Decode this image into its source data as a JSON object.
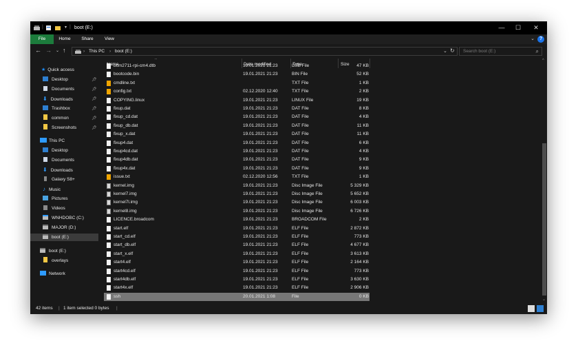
{
  "window": {
    "title": "boot (E:)",
    "controls": {
      "minimize": "—",
      "maximize": "☐",
      "close": "✕"
    }
  },
  "ribbon": {
    "tabs": [
      "File",
      "Home",
      "Share",
      "View"
    ],
    "help": "?"
  },
  "address": {
    "crumbs": [
      "This PC",
      "boot (E:)"
    ],
    "search_placeholder": "Search boot (E:)"
  },
  "nav": {
    "quick_access": "Quick access",
    "quick_items": [
      "Desktop",
      "Documents",
      "Downloads",
      "Trashbox",
      "common",
      "Screenshots"
    ],
    "this_pc": "This PC",
    "pc_items": [
      "Desktop",
      "Documents",
      "Downloads",
      "Galaxy S8+",
      "Music",
      "Pictures",
      "Videos",
      "WNHDOBC (C:)",
      "MAJOR (D:)",
      "boot (E:)"
    ],
    "drive_root": "boot (E:)",
    "drive_sub": "overlays",
    "network": "Network"
  },
  "columns": {
    "name": "Name",
    "date": "Date modified",
    "type": "Type",
    "size": "Size"
  },
  "files": [
    {
      "name": "bcm2711-rpi-cm4.dtb",
      "date": "19.01.2021 21:23",
      "type": "DTB File",
      "size": "47 KB",
      "icon": "file"
    },
    {
      "name": "bootcode.bin",
      "date": "19.01.2021 21:23",
      "type": "BIN File",
      "size": "52 KB",
      "icon": "file"
    },
    {
      "name": "cmdline.txt",
      "date": "",
      "type": "TXT File",
      "size": "1 KB",
      "icon": "config"
    },
    {
      "name": "config.txt",
      "date": "02.12.2020 12:40",
      "type": "TXT File",
      "size": "2 KB",
      "icon": "config"
    },
    {
      "name": "COPYING.linux",
      "date": "19.01.2021 21:23",
      "type": "LINUX File",
      "size": "19 KB",
      "icon": "file"
    },
    {
      "name": "fixup.dat",
      "date": "19.01.2021 21:23",
      "type": "DAT File",
      "size": "8 KB",
      "icon": "file"
    },
    {
      "name": "fixup_cd.dat",
      "date": "19.01.2021 21:23",
      "type": "DAT File",
      "size": "4 KB",
      "icon": "file"
    },
    {
      "name": "fixup_db.dat",
      "date": "19.01.2021 21:23",
      "type": "DAT File",
      "size": "11 KB",
      "icon": "file"
    },
    {
      "name": "fixup_x.dat",
      "date": "19.01.2021 21:23",
      "type": "DAT File",
      "size": "11 KB",
      "icon": "file"
    },
    {
      "name": "fixup4.dat",
      "date": "19.01.2021 21:23",
      "type": "DAT File",
      "size": "6 KB",
      "icon": "file"
    },
    {
      "name": "fixup4cd.dat",
      "date": "19.01.2021 21:23",
      "type": "DAT File",
      "size": "4 KB",
      "icon": "file"
    },
    {
      "name": "fixup4db.dat",
      "date": "19.01.2021 21:23",
      "type": "DAT File",
      "size": "9 KB",
      "icon": "file"
    },
    {
      "name": "fixup4x.dat",
      "date": "19.01.2021 21:23",
      "type": "DAT File",
      "size": "9 KB",
      "icon": "file"
    },
    {
      "name": "issue.txt",
      "date": "02.12.2020 12:56",
      "type": "TXT File",
      "size": "1 KB",
      "icon": "config"
    },
    {
      "name": "kernel.img",
      "date": "19.01.2021 21:23",
      "type": "Disc Image File",
      "size": "5 329 KB",
      "icon": "image"
    },
    {
      "name": "kernel7.img",
      "date": "19.01.2021 21:23",
      "type": "Disc Image File",
      "size": "5 652 KB",
      "icon": "image"
    },
    {
      "name": "kernel7l.img",
      "date": "19.01.2021 21:23",
      "type": "Disc Image File",
      "size": "6 003 KB",
      "icon": "image"
    },
    {
      "name": "kernel8.img",
      "date": "19.01.2021 21:23",
      "type": "Disc Image File",
      "size": "6 726 KB",
      "icon": "image"
    },
    {
      "name": "LICENCE.broadcom",
      "date": "19.01.2021 21:23",
      "type": "BROADCOM File",
      "size": "2 KB",
      "icon": "file"
    },
    {
      "name": "start.elf",
      "date": "19.01.2021 21:23",
      "type": "ELF File",
      "size": "2 872 KB",
      "icon": "file"
    },
    {
      "name": "start_cd.elf",
      "date": "19.01.2021 21:23",
      "type": "ELF File",
      "size": "773 KB",
      "icon": "file"
    },
    {
      "name": "start_db.elf",
      "date": "19.01.2021 21:23",
      "type": "ELF File",
      "size": "4 677 KB",
      "icon": "file"
    },
    {
      "name": "start_x.elf",
      "date": "19.01.2021 21:23",
      "type": "ELF File",
      "size": "3 613 KB",
      "icon": "file"
    },
    {
      "name": "start4.elf",
      "date": "19.01.2021 21:23",
      "type": "ELF File",
      "size": "2 164 KB",
      "icon": "file"
    },
    {
      "name": "start4cd.elf",
      "date": "19.01.2021 21:23",
      "type": "ELF File",
      "size": "773 KB",
      "icon": "file"
    },
    {
      "name": "start4db.elf",
      "date": "19.01.2021 21:23",
      "type": "ELF File",
      "size": "3 630 KB",
      "icon": "file"
    },
    {
      "name": "start4x.elf",
      "date": "19.01.2021 21:23",
      "type": "ELF File",
      "size": "2 906 KB",
      "icon": "file"
    },
    {
      "name": "ssh",
      "date": "20.01.2021 1:08",
      "type": "File",
      "size": "0 KB",
      "icon": "file",
      "selected": true
    }
  ],
  "status": {
    "item_count": "42 items",
    "selection": "1 item selected  0 bytes"
  },
  "colors": {
    "window_bg": "#191919",
    "file_tab": "#1c7c3c",
    "selected_row": "#777777",
    "folder": "#f2c744",
    "drive_blue": "#1a73e8"
  }
}
